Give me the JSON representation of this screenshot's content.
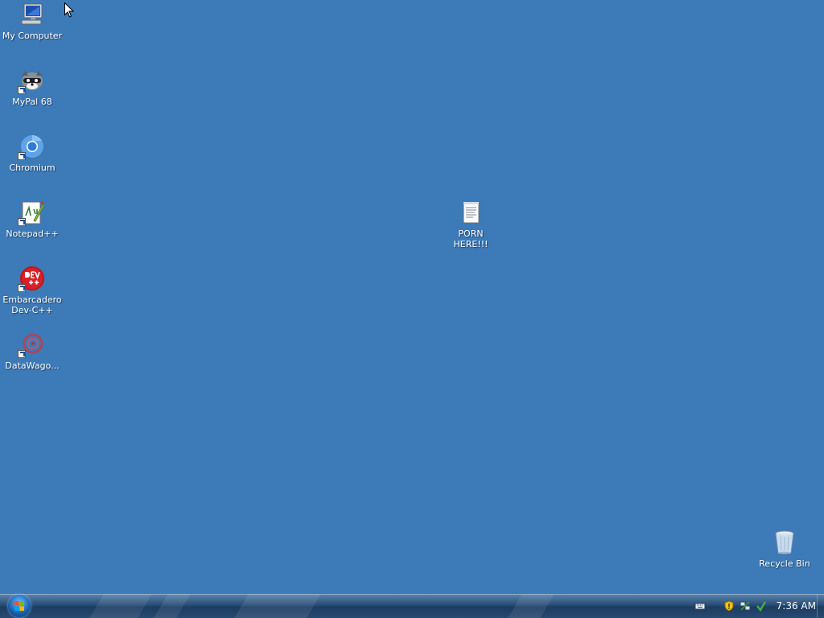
{
  "desktop": {
    "background_color": "#3c7ab8",
    "icons": [
      {
        "label": "My Computer",
        "icon": "computer-icon"
      },
      {
        "label": "MyPal 68",
        "icon": "raccoon-browser-icon",
        "shortcut": true
      },
      {
        "label": "Chromium",
        "icon": "chromium-icon",
        "shortcut": true
      },
      {
        "label": "Notepad++",
        "icon": "notepad-plus-plus-icon",
        "shortcut": true
      },
      {
        "label": "Embarcadero Dev-C++",
        "icon": "devcpp-icon",
        "shortcut": true
      },
      {
        "label": "DataWago...",
        "icon": "datawagon-icon",
        "shortcut": true
      },
      {
        "label": "PORN HERE!!!",
        "icon": "text-file-icon"
      },
      {
        "label": "Recycle Bin",
        "icon": "recycle-bin-icon"
      }
    ]
  },
  "taskbar": {
    "start_icon": "windows-start-orb-icon",
    "tray_icons": [
      "keyboard-icon",
      "security-shield-icon",
      "network-icon",
      "update-icon"
    ],
    "clock": "7:36 AM"
  }
}
